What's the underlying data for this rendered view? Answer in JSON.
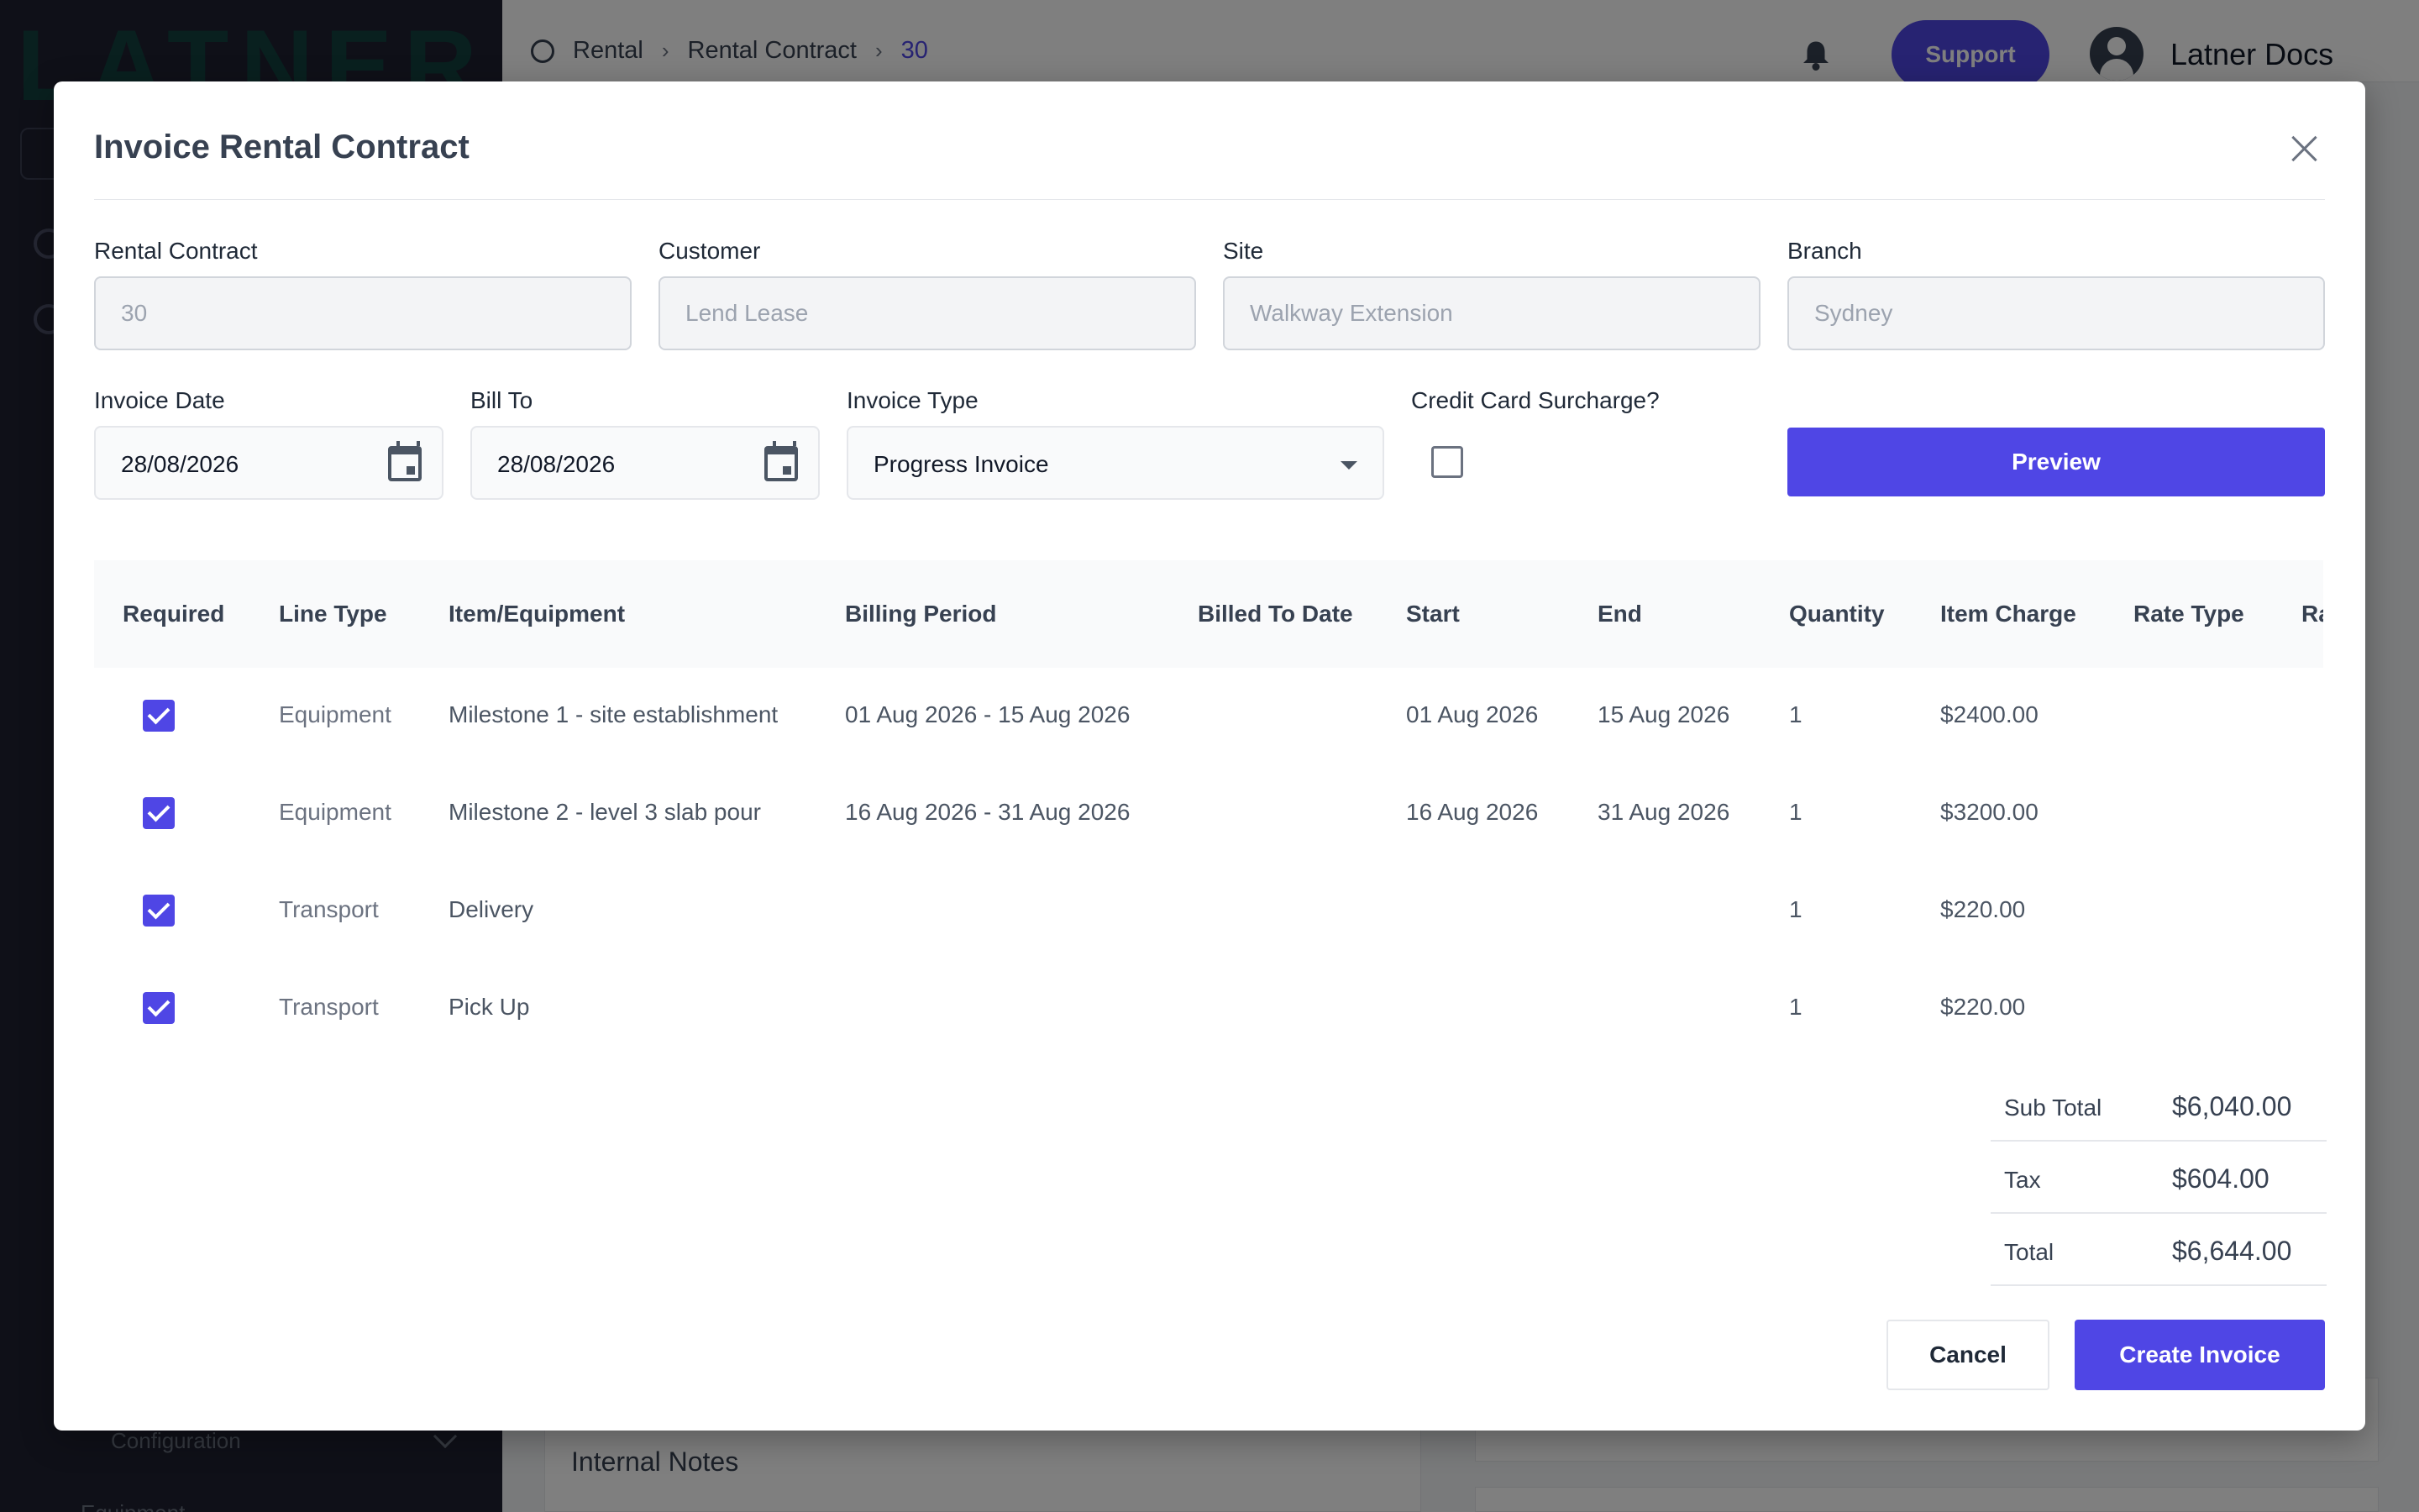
{
  "app": {
    "logo_text": "LATNER",
    "sidebar": {
      "config_label": "Configuration",
      "equipment_label": "Equipment"
    },
    "breadcrumb": [
      "Rental",
      "Rental Contract",
      "30"
    ],
    "support_label": "Support",
    "user_name": "Latner Docs",
    "background_notes_label": "Internal Notes"
  },
  "modal": {
    "title": "Invoice Rental Contract",
    "fields": {
      "rental_contract": {
        "label": "Rental Contract",
        "value": "30"
      },
      "customer": {
        "label": "Customer",
        "value": "Lend Lease"
      },
      "site": {
        "label": "Site",
        "value": "Walkway Extension"
      },
      "branch": {
        "label": "Branch",
        "value": "Sydney"
      },
      "invoice_date": {
        "label": "Invoice Date",
        "value": "28/08/2026"
      },
      "bill_to": {
        "label": "Bill To",
        "value": "28/08/2026"
      },
      "invoice_type": {
        "label": "Invoice Type",
        "value": "Progress Invoice"
      },
      "credit_card_surcharge": {
        "label": "Credit Card Surcharge?",
        "checked": false
      }
    },
    "preview_label": "Preview",
    "table": {
      "headers": [
        "Required",
        "Line Type",
        "Item/Equipment",
        "Billing Period",
        "Billed To Date",
        "Start",
        "End",
        "Quantity",
        "Item Charge",
        "Rate Type",
        "Ra"
      ],
      "rows": [
        {
          "required": true,
          "line_type": "Equipment",
          "item": "Milestone 1 - site establishment",
          "billing_period": "01 Aug 2026 - 15 Aug 2026",
          "billed_to_date": "",
          "start": "01 Aug 2026",
          "end": "15 Aug 2026",
          "quantity": "1",
          "item_charge": "$2400.00",
          "rate_type": ""
        },
        {
          "required": true,
          "line_type": "Equipment",
          "item": "Milestone 2 - level 3 slab pour",
          "billing_period": "16 Aug 2026 - 31 Aug 2026",
          "billed_to_date": "",
          "start": "16 Aug 2026",
          "end": "31 Aug 2026",
          "quantity": "1",
          "item_charge": "$3200.00",
          "rate_type": ""
        },
        {
          "required": true,
          "line_type": "Transport",
          "item": "Delivery",
          "billing_period": "",
          "billed_to_date": "",
          "start": "",
          "end": "",
          "quantity": "1",
          "item_charge": "$220.00",
          "rate_type": ""
        },
        {
          "required": true,
          "line_type": "Transport",
          "item": "Pick Up",
          "billing_period": "",
          "billed_to_date": "",
          "start": "",
          "end": "",
          "quantity": "1",
          "item_charge": "$220.00",
          "rate_type": ""
        }
      ]
    },
    "totals": [
      {
        "label": "Sub Total",
        "value": "$6,040.00"
      },
      {
        "label": "Tax",
        "value": "$604.00"
      },
      {
        "label": "Total",
        "value": "$6,644.00"
      }
    ],
    "cancel_label": "Cancel",
    "create_label": "Create Invoice"
  },
  "colors": {
    "accent": "#4f46e5",
    "sidebar_bg": "#1e2130",
    "overlay": "rgba(0,0,0,0.5)"
  },
  "icons": {
    "bell": "bell-icon",
    "avatar": "user-avatar-icon",
    "calendar": "calendar-icon",
    "close": "close-icon",
    "dropdown": "caret-down-icon",
    "checkbox_checked": "checkbox-checked-icon"
  }
}
